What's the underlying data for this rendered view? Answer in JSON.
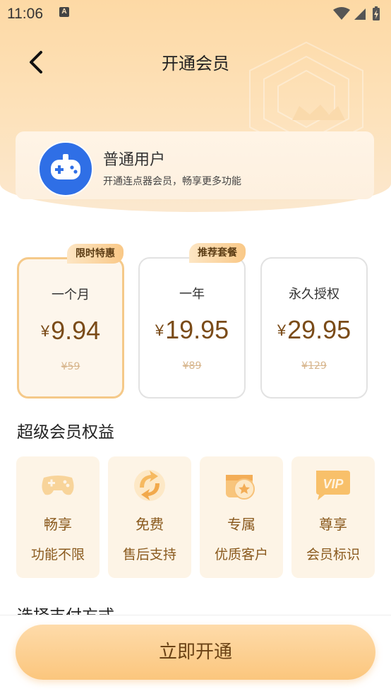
{
  "status_bar": {
    "time": "11:06",
    "indicator": "A",
    "icons": [
      "wifi-icon",
      "signal-icon",
      "battery-charging-icon"
    ]
  },
  "header": {
    "back_icon": "chevron-left-icon",
    "title": "开通会员"
  },
  "user": {
    "avatar_icon": "gamepad-icon",
    "name": "普通用户",
    "description": "开通连点器会员，畅享更多功能"
  },
  "plans": [
    {
      "tag": "限时特惠",
      "name": "一个月",
      "currency": "¥",
      "price": "9.94",
      "original": "¥59",
      "selected": true
    },
    {
      "tag": "推荐套餐",
      "name": "一年",
      "currency": "¥",
      "price": "19.95",
      "original": "¥89",
      "selected": false
    },
    {
      "tag": "",
      "name": "永久授权",
      "currency": "¥",
      "price": "29.95",
      "original": "¥129",
      "selected": false
    }
  ],
  "benefits_section": {
    "title": "超级会员权益",
    "items": [
      {
        "icon": "gamepad-icon",
        "title": "畅享",
        "subtitle": "功能不限"
      },
      {
        "icon": "refresh-icon",
        "title": "免费",
        "subtitle": "售后支持"
      },
      {
        "icon": "star-badge-icon",
        "title": "专属",
        "subtitle": "优质客户"
      },
      {
        "icon": "vip-icon",
        "title": "尊享",
        "subtitle": "会员标识"
      }
    ]
  },
  "payment_section": {
    "title": "选择支付方式"
  },
  "cta": {
    "label": "立即开通"
  },
  "colors": {
    "accent": "#fbc67d",
    "price_text": "#7a4b18",
    "benefit_bg": "#fdf4e6",
    "avatar_blue": "#2f6fe6"
  }
}
